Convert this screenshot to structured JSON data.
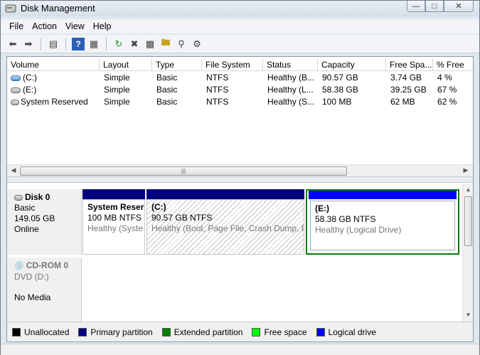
{
  "window": {
    "title": "Disk Management"
  },
  "menu": [
    "File",
    "Action",
    "View",
    "Help"
  ],
  "volume_list": {
    "columns": [
      "Volume",
      "Layout",
      "Type",
      "File System",
      "Status",
      "Capacity",
      "Free Spa...",
      "% Free"
    ],
    "rows": [
      [
        "(C:)",
        "Simple",
        "Basic",
        "NTFS",
        "Healthy (B...",
        "90.57 GB",
        "3.74 GB",
        "4 %"
      ],
      [
        "(E:)",
        "Simple",
        "Basic",
        "NTFS",
        "Healthy (L...",
        "58.38 GB",
        "39.25 GB",
        "67 %"
      ],
      [
        "System Reserved",
        "Simple",
        "Basic",
        "NTFS",
        "Healthy (S...",
        "100 MB",
        "62 MB",
        "62 %"
      ]
    ]
  },
  "disks": {
    "disk0": {
      "name": "Disk 0",
      "type": "Basic",
      "size": "149.05 GB",
      "state": "Online"
    },
    "cdrom0": {
      "name": "CD-ROM 0",
      "type": "DVD (D:)",
      "media": "No Media"
    }
  },
  "partitions": {
    "system_reserved": {
      "name": "System Reser",
      "size": "100 MB NTFS",
      "status": "Healthy (Syste"
    },
    "c": {
      "name": "(C:)",
      "size": "90.57 GB NTFS",
      "status": "Healthy (Boot, Page File, Crash Dump, P"
    },
    "e": {
      "name": "(E:)",
      "size": "58.38 GB NTFS",
      "status": "Healthy (Logical Drive)"
    }
  },
  "legend": [
    {
      "label": "Unallocated",
      "color": "#000000"
    },
    {
      "label": "Primary partition",
      "color": "#000080"
    },
    {
      "label": "Extended partition",
      "color": "#008000"
    },
    {
      "label": "Free space",
      "color": "#00ff00"
    },
    {
      "label": "Logical drive",
      "color": "#0000ff"
    }
  ],
  "colors": {
    "primary": "#000080",
    "extended": "#008000",
    "logical": "#0000ff"
  }
}
